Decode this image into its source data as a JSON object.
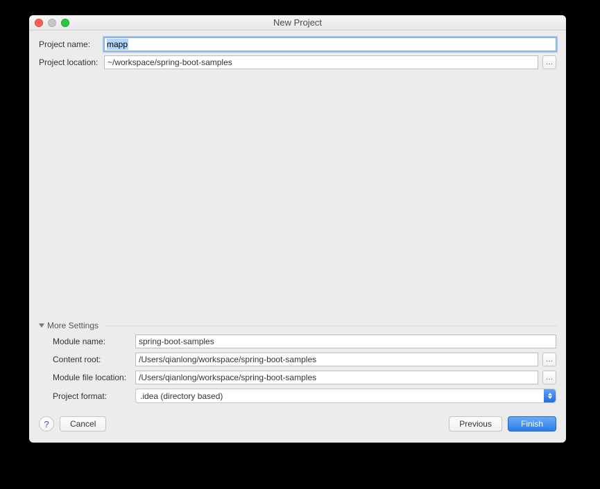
{
  "window": {
    "title": "New Project"
  },
  "form": {
    "project_name_label": "Project name:",
    "project_name_value": "mapp",
    "project_location_label": "Project location:",
    "project_location_value": "~/workspace/spring-boot-samples"
  },
  "more": {
    "section_title": "More Settings",
    "module_name_label": "Module name:",
    "module_name_value": "spring-boot-samples",
    "content_root_label": "Content root:",
    "content_root_value": "/Users/qianlong/workspace/spring-boot-samples",
    "module_file_location_label": "Module file location:",
    "module_file_location_value": "/Users/qianlong/workspace/spring-boot-samples",
    "project_format_label": "Project format:",
    "project_format_value": ".idea (directory based)"
  },
  "buttons": {
    "help": "?",
    "cancel": "Cancel",
    "previous": "Previous",
    "finish": "Finish",
    "browse": "…"
  }
}
